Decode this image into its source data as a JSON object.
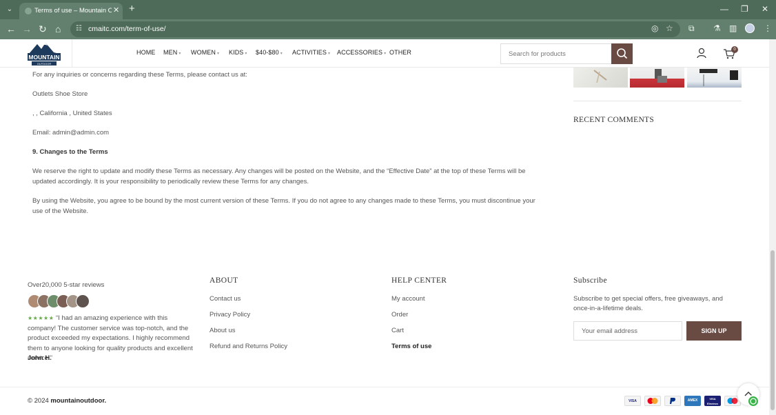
{
  "browser": {
    "tab_title": "Terms of use – Mountain Outdoor",
    "url": "cmaitc.com/term-of-use/",
    "icons": [
      "tab-search-icon",
      "close-icon",
      "plus-icon",
      "minimize-icon",
      "maximize-icon",
      "window-close-icon",
      "back-icon",
      "forward-icon",
      "reload-icon",
      "home-icon",
      "site-info-icon",
      "eye-off-icon",
      "star-icon",
      "extensions-icon",
      "labs-icon",
      "sidebar-icon",
      "profile-icon",
      "kebab-menu-icon"
    ]
  },
  "header": {
    "logo_text": "MOUNTAIN",
    "logo_subtext": "OUTDOOR",
    "nav": [
      {
        "label": "HOME",
        "dropdown": false
      },
      {
        "label": "MEN",
        "dropdown": true
      },
      {
        "label": "WOMEN",
        "dropdown": true
      },
      {
        "label": "KIDS",
        "dropdown": true
      },
      {
        "label": "$40-$80",
        "dropdown": true
      },
      {
        "label": "ACTIVITIES",
        "dropdown": true
      },
      {
        "label": "ACCESSORIES",
        "dropdown": true
      },
      {
        "label": "OTHER",
        "dropdown": false
      }
    ],
    "search_placeholder": "Search for products",
    "cart_count": "0"
  },
  "content": {
    "contact_intro": "For any inquiries or concerns regarding these Terms, please contact us at:",
    "store_name": "Outlets Shoe Store",
    "address": ", , California , United States",
    "email": "Email: admin@admin.com",
    "section_heading": "9. Changes to the Terms",
    "changes_paragraph": "We reserve the right to update and modify these Terms as necessary. Any changes will be posted on the Website, and the “Effective Date” at the top of these Terms will be updated accordingly. It is your responsibility to periodically review these Terms for any changes.",
    "agreement_paragraph": "By using the Website, you agree to be bound by the most current version of these Terms. If you do not agree to any changes made to these Terms, you must discontinue your use of the Website."
  },
  "sidebar": {
    "recent_comments_heading": "RECENT COMMENTS"
  },
  "footer": {
    "reviews_title": "Over20,000 5-star reviews",
    "stars": "★★★★★",
    "review_text": "“I had an amazing experience with this company! The customer service was top-notch, and the product exceeded my expectations. I highly recommend them to anyone looking for quality products and excellent service.”",
    "reviewer": "John H.",
    "about_heading": "ABOUT",
    "about_links": [
      "Contact us",
      "Privacy Policy",
      "About us",
      "Refund and Returns Policy"
    ],
    "help_heading": "HELP CENTER",
    "help_links": [
      "My account",
      "Order",
      "Cart",
      "Terms of use"
    ],
    "help_active": "Terms of use",
    "subscribe_heading": "Subscribe",
    "subscribe_text": "Subscribe to get special offers, free giveaways, and once-in-a-lifetime deals.",
    "email_placeholder": "Your email address",
    "signup_label": "SIGN UP",
    "copyright_symbol": "©",
    "copyright_year": "2024",
    "copyright_site": "mountainoutdoor.",
    "payments": [
      "VISA",
      "mastercard",
      "PayPal",
      "AMEX",
      "VISA Electron",
      "Maestro"
    ]
  },
  "colors": {
    "brand": "#6a4b43",
    "browser_chrome": "#4e6a58",
    "accent_green": "#66a848"
  }
}
